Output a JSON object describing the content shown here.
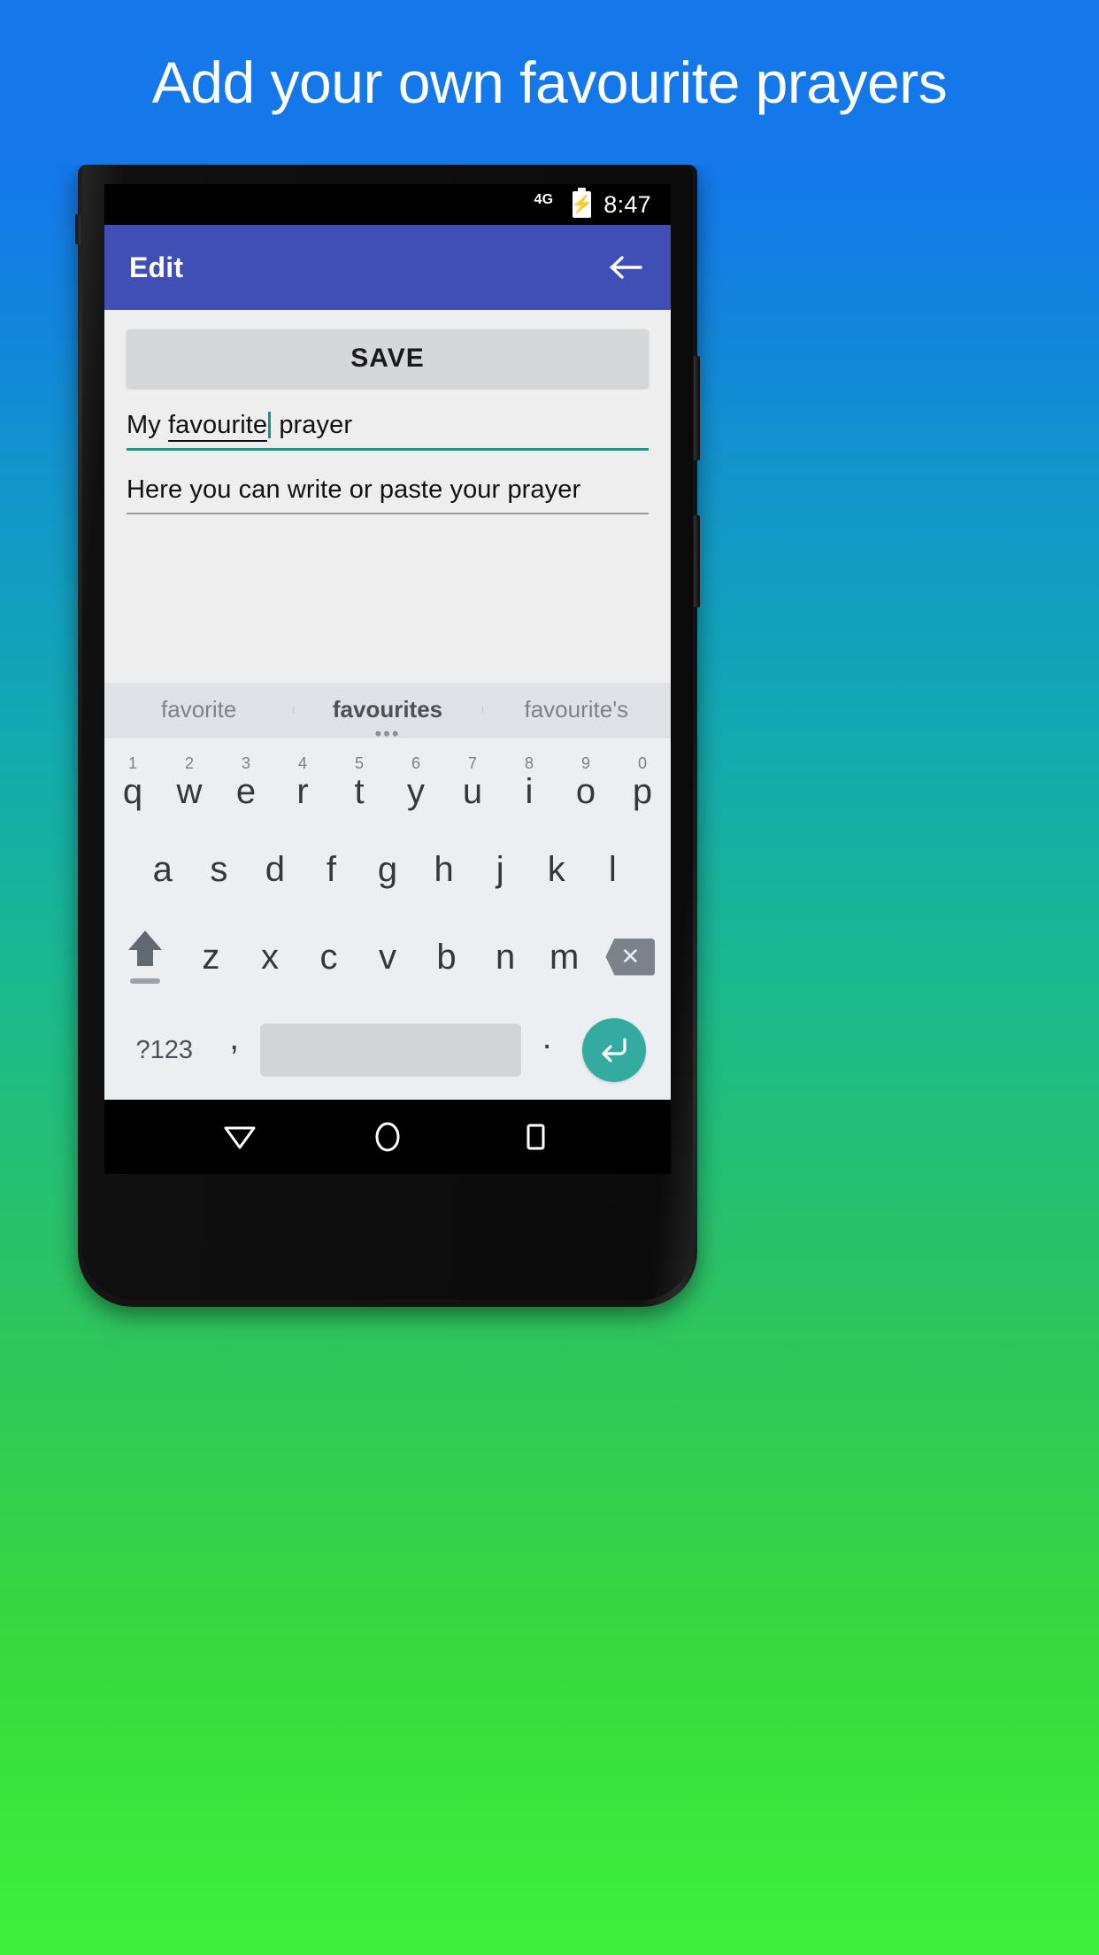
{
  "banner": {
    "text": "Add your own favourite prayers",
    "background_color": "#1478eb",
    "text_color": "#ffffff"
  },
  "background": {
    "gradient_from": "#1478eb",
    "gradient_mid": "#13a9b2",
    "gradient_to": "#3ef03c"
  },
  "status_bar": {
    "network": "4G",
    "battery_icon": "battery-charging-icon",
    "clock": "8:47"
  },
  "app_bar": {
    "title": "Edit",
    "back_icon": "arrow-left-icon",
    "color": "#3f4fb5"
  },
  "content": {
    "save_label": "SAVE",
    "title_field": {
      "text_before": "My ",
      "composing": "favourite",
      "text_after": " prayer",
      "underline_color": "#0f9b8c",
      "caret_color": "#0e9688"
    },
    "body_field": {
      "value": "Here you can write or paste your prayer",
      "underline_color": "#9b9b9b"
    }
  },
  "keyboard": {
    "suggestions": [
      {
        "label": "favorite",
        "active": false
      },
      {
        "label": "favourites",
        "active": true
      },
      {
        "label": "favourite's",
        "active": false
      }
    ],
    "more_glyph": "•••",
    "row_top": [
      {
        "letter": "q",
        "num": "1"
      },
      {
        "letter": "w",
        "num": "2"
      },
      {
        "letter": "e",
        "num": "3"
      },
      {
        "letter": "r",
        "num": "4"
      },
      {
        "letter": "t",
        "num": "5"
      },
      {
        "letter": "y",
        "num": "6"
      },
      {
        "letter": "u",
        "num": "7"
      },
      {
        "letter": "i",
        "num": "8"
      },
      {
        "letter": "o",
        "num": "9"
      },
      {
        "letter": "p",
        "num": "0"
      }
    ],
    "row_home": [
      "a",
      "s",
      "d",
      "f",
      "g",
      "h",
      "j",
      "k",
      "l"
    ],
    "row_bottom": [
      "z",
      "x",
      "c",
      "v",
      "b",
      "n",
      "m"
    ],
    "shift_icon": "shift-arrow-icon",
    "backspace_icon": "backspace-icon",
    "backspace_glyph": "✕",
    "symbols_label": "?123",
    "comma_label": ",",
    "period_label": ".",
    "enter_icon": "enter-return-icon",
    "enter_glyph": "↵",
    "enter_color": "#34aba0"
  },
  "nav_bar": {
    "back_icon": "nav-back-triangle-icon",
    "home_icon": "nav-home-circle-icon",
    "recents_icon": "nav-recents-square-icon"
  }
}
